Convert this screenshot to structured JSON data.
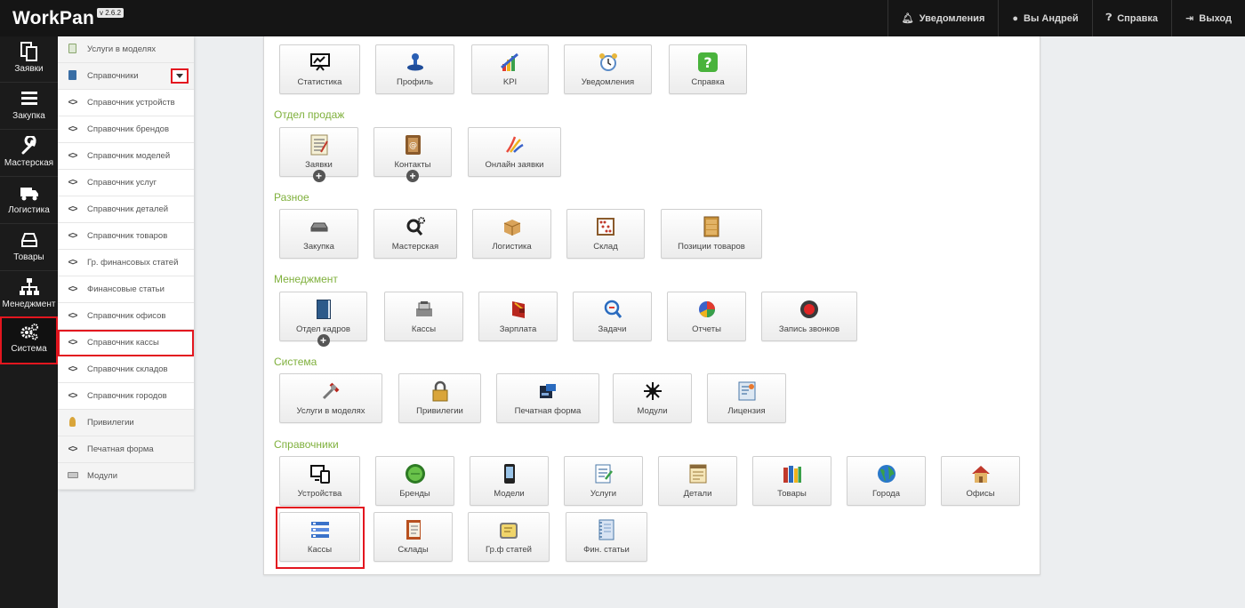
{
  "header": {
    "brand": "WorkPan",
    "version": "v 2.6.2",
    "nav": [
      {
        "label": "Уведомления",
        "icon": "bell-icon"
      },
      {
        "label": "Вы Андрей",
        "icon": "user-icon"
      },
      {
        "label": "Справка",
        "icon": "question-icon"
      },
      {
        "label": "Выход",
        "icon": "logout-icon"
      }
    ]
  },
  "rail": [
    {
      "label": "Заявки",
      "icon": "documents-icon"
    },
    {
      "label": "Закупка",
      "icon": "menu-icon"
    },
    {
      "label": "Мастерская",
      "icon": "wrench-icon"
    },
    {
      "label": "Логистика",
      "icon": "truck-icon"
    },
    {
      "label": "Товары",
      "icon": "drive-icon"
    },
    {
      "label": "Менеджмент",
      "icon": "sitemap-icon"
    },
    {
      "label": "Система",
      "icon": "gears-icon",
      "active": true
    }
  ],
  "submenu": [
    {
      "label": "Услуги в моделях",
      "icon": "page-icon",
      "group": true
    },
    {
      "label": "Справочники",
      "icon": "book-icon",
      "group": true,
      "expanded": true
    },
    {
      "label": "Справочник устройств",
      "icon": "code-icon"
    },
    {
      "label": "Справочник брендов",
      "icon": "code-icon"
    },
    {
      "label": "Справочник моделей",
      "icon": "code-icon"
    },
    {
      "label": "Справочник услуг",
      "icon": "code-icon"
    },
    {
      "label": "Справочник деталей",
      "icon": "code-icon"
    },
    {
      "label": "Справочник товаров",
      "icon": "code-icon"
    },
    {
      "label": "Гр. финансовых статей",
      "icon": "code-icon"
    },
    {
      "label": "Финансовые статьи",
      "icon": "code-icon"
    },
    {
      "label": "Справочник офисов",
      "icon": "code-icon"
    },
    {
      "label": "Справочник кассы",
      "icon": "code-icon",
      "selected": true
    },
    {
      "label": "Справочник складов",
      "icon": "code-icon"
    },
    {
      "label": "Справочник городов",
      "icon": "code-icon"
    },
    {
      "label": "Привилегии",
      "icon": "key-icon",
      "group": true
    },
    {
      "label": "Печатная форма",
      "icon": "code-icon",
      "group": true
    },
    {
      "label": "Модули",
      "icon": "keyboard-icon",
      "group": true
    }
  ],
  "sections": [
    {
      "title": "",
      "tiles": [
        {
          "label": "Статистика",
          "icon": "presentation-icon"
        },
        {
          "label": "Профиль",
          "icon": "stamp-icon"
        },
        {
          "label": "KPI",
          "icon": "chart-icon"
        },
        {
          "label": "Уведомления",
          "icon": "alarm-clock-icon"
        },
        {
          "label": "Справка",
          "icon": "help-icon"
        }
      ]
    },
    {
      "title": "Отдел продаж",
      "tiles": [
        {
          "label": "Заявки",
          "icon": "notepad-icon",
          "plus": true
        },
        {
          "label": "Контакты",
          "icon": "address-book-icon",
          "plus": true
        },
        {
          "label": "Онлайн заявки",
          "icon": "online-request-icon"
        }
      ]
    },
    {
      "title": "Разное",
      "tiles": [
        {
          "label": "Закупка",
          "icon": "drive-icon"
        },
        {
          "label": "Мастерская",
          "icon": "magnifier-gear-icon"
        },
        {
          "label": "Логистика",
          "icon": "box-icon"
        },
        {
          "label": "Склад",
          "icon": "abacus-icon"
        },
        {
          "label": "Позиции товаров",
          "icon": "cabinet-icon"
        }
      ]
    },
    {
      "title": "Менеджмент",
      "tiles": [
        {
          "label": "Отдел кадров",
          "icon": "book-icon",
          "plus": true
        },
        {
          "label": "Кассы",
          "icon": "cash-register-icon"
        },
        {
          "label": "Зарплата",
          "icon": "wallet-icon"
        },
        {
          "label": "Задачи",
          "icon": "search-task-icon"
        },
        {
          "label": "Отчеты",
          "icon": "pie-chart-icon"
        },
        {
          "label": "Запись звонков",
          "icon": "record-icon"
        }
      ]
    },
    {
      "title": "Система",
      "tiles": [
        {
          "label": "Услуги в моделях",
          "icon": "tools-icon"
        },
        {
          "label": "Привилегии",
          "icon": "lock-icon"
        },
        {
          "label": "Печатная форма",
          "icon": "printer-card-icon"
        },
        {
          "label": "Модули",
          "icon": "modules-icon"
        },
        {
          "label": "Лицензия",
          "icon": "certificate-icon"
        }
      ]
    },
    {
      "title": "Справочники",
      "tiles": [
        {
          "label": "Устройства",
          "icon": "devices-icon"
        },
        {
          "label": "Бренды",
          "icon": "green-button-icon"
        },
        {
          "label": "Модели",
          "icon": "phone-icon"
        },
        {
          "label": "Услуги",
          "icon": "checklist-icon"
        },
        {
          "label": "Детали",
          "icon": "note-icon"
        },
        {
          "label": "Товары",
          "icon": "books-icon"
        },
        {
          "label": "Города",
          "icon": "globe-icon"
        },
        {
          "label": "Офисы",
          "icon": "house-icon"
        },
        {
          "label": "Кассы",
          "icon": "list-icon",
          "selected": true
        },
        {
          "label": "Склады",
          "icon": "ledger-icon"
        },
        {
          "label": "Гр.ф статей",
          "icon": "folder-note-icon"
        },
        {
          "label": "Фин. статьи",
          "icon": "notebook-icon"
        }
      ]
    }
  ]
}
